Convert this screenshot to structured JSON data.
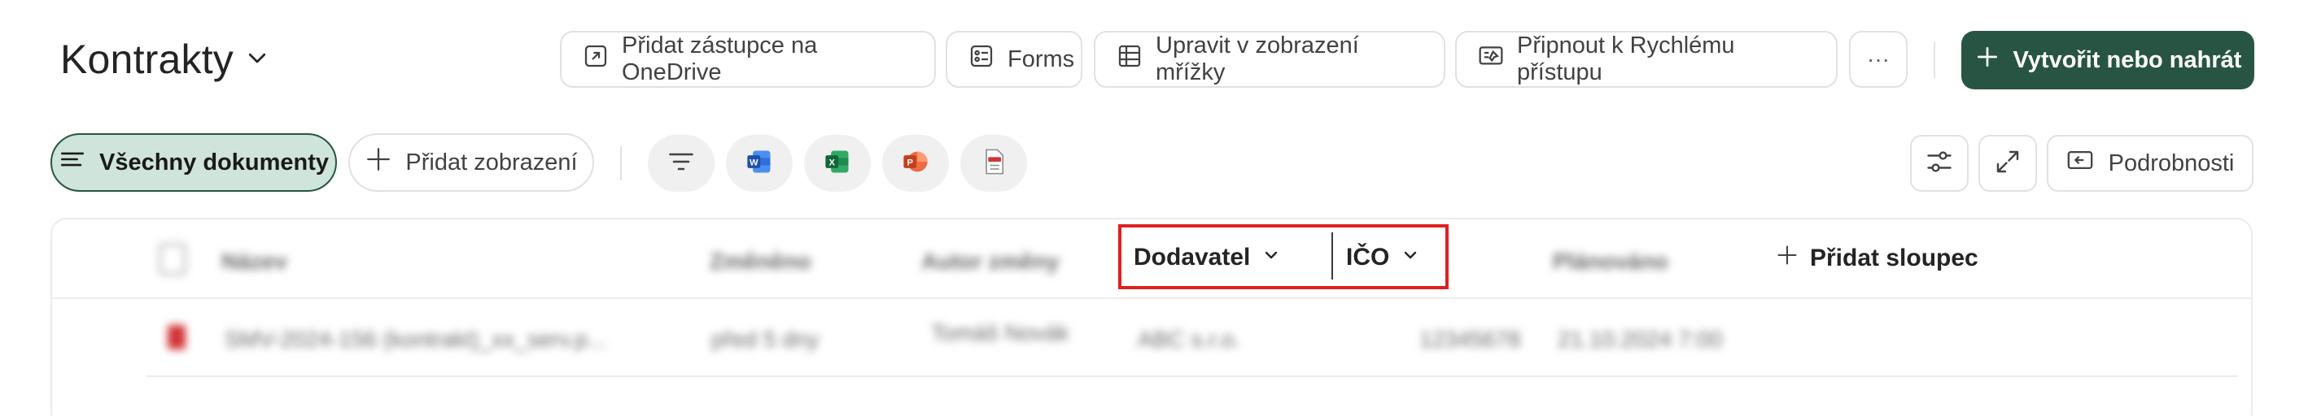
{
  "page": {
    "title": "Kontrakty"
  },
  "command_bar": {
    "onedrive_label": "Přidat zástupce na OneDrive",
    "forms_label": "Forms",
    "grid_label": "Upravit v zobrazení mřížky",
    "pin_label": "Připnout k Rychlému přístupu",
    "more_label": "···",
    "create_label": "Vytvořit nebo nahrát"
  },
  "views": {
    "active_label": "Všechny dokumenty",
    "add_label": "Přidat zobrazení"
  },
  "toolbar": {
    "details_label": "Podrobnosti"
  },
  "table": {
    "columns": {
      "name": "Název",
      "modified": "Změněno",
      "modified_by": "Autor změny",
      "supplier": "Dodavatel",
      "ico": "IČO",
      "planned": "Plánováno",
      "add_column": "Přidat sloupec"
    },
    "rows": [
      {
        "name": "SMV-2024-156 (kontrakt)_xx_serv.p...",
        "modified": "před 5 dny",
        "modified_by": "Tomáš Novák",
        "supplier": "ABC s.r.o.",
        "ico": "12345678",
        "planned": "21.10.2024 7:00"
      }
    ]
  },
  "colors": {
    "accent": "#285543",
    "highlight": "#e02020"
  },
  "icons": [
    "chevron-down-icon",
    "shortcut-icon",
    "forms-icon",
    "grid-icon",
    "pin-icon",
    "plus-icon",
    "list-icon",
    "filter-icon",
    "word-icon",
    "excel-icon",
    "powerpoint-icon",
    "pdf-icon",
    "settings-sliders-icon",
    "expand-icon",
    "details-panel-icon"
  ]
}
